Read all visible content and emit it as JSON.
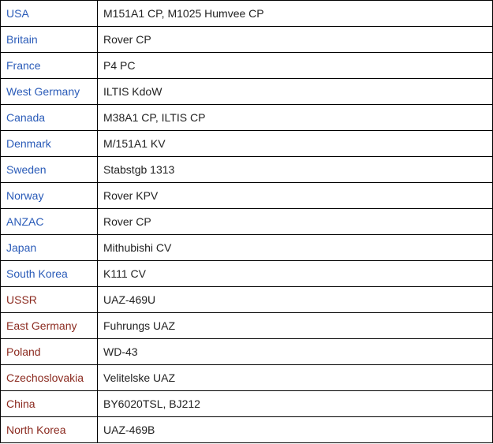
{
  "colors": {
    "blue_bloc": "#2a5bb8",
    "red_bloc": "#8b2a1f",
    "vehicle_text": "#222222",
    "border": "#000000"
  },
  "rows": [
    {
      "country": "USA",
      "vehicle": "M151A1 CP, M1025 Humvee CP",
      "bloc": "blue"
    },
    {
      "country": "Britain",
      "vehicle": "Rover CP",
      "bloc": "blue"
    },
    {
      "country": "France",
      "vehicle": "P4 PC",
      "bloc": "blue"
    },
    {
      "country": "West Germany",
      "vehicle": "ILTIS KdoW",
      "bloc": "blue"
    },
    {
      "country": "Canada",
      "vehicle": "M38A1 CP, ILTIS CP",
      "bloc": "blue"
    },
    {
      "country": "Denmark",
      "vehicle": "M/151A1 KV",
      "bloc": "blue"
    },
    {
      "country": "Sweden",
      "vehicle": "Stabstgb 1313",
      "bloc": "blue"
    },
    {
      "country": "Norway",
      "vehicle": "Rover KPV",
      "bloc": "blue"
    },
    {
      "country": "ANZAC",
      "vehicle": "Rover CP",
      "bloc": "blue"
    },
    {
      "country": "Japan",
      "vehicle": "Mithubishi CV",
      "bloc": "blue"
    },
    {
      "country": "South Korea",
      "vehicle": "K111 CV",
      "bloc": "blue"
    },
    {
      "country": "USSR",
      "vehicle": "UAZ-469U",
      "bloc": "red"
    },
    {
      "country": "East Germany",
      "vehicle": "Fuhrungs UAZ",
      "bloc": "red"
    },
    {
      "country": "Poland",
      "vehicle": "WD-43",
      "bloc": "red"
    },
    {
      "country": "Czechoslovakia",
      "vehicle": "Velitelske UAZ",
      "bloc": "red"
    },
    {
      "country": "China",
      "vehicle": "BY6020TSL, BJ212",
      "bloc": "red"
    },
    {
      "country": "North Korea",
      "vehicle": "UAZ-469B",
      "bloc": "red"
    }
  ]
}
